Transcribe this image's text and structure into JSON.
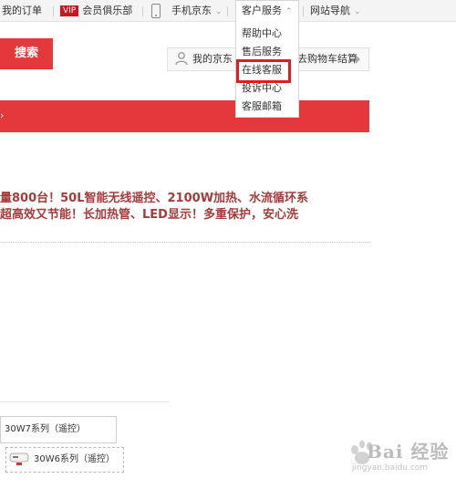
{
  "topbar": {
    "my_orders": "我的订单",
    "vip_badge": "VIP",
    "vip_club": "会员俱乐部",
    "mobile_jd": "手机京东",
    "customer_service": "客户服务",
    "site_nav": "网站导航",
    "caret": "⌄",
    "mobile_icon": "phone-icon"
  },
  "service_menu": {
    "items": [
      "帮助中心",
      "售后服务",
      "在线客服",
      "投诉中心",
      "客服邮箱"
    ],
    "highlighted_index": 2,
    "highlight_color": "#e01c1c"
  },
  "search": {
    "button_label": "搜索",
    "accent_color": "#e4393c"
  },
  "cart": {
    "left_text": "我的京东",
    "right_text": "去购物车结算"
  },
  "product": {
    "headline_line1": "量800台！50L智能无线遥控、2100W加热、水流循环系",
    "headline_line2": "超高效又节能！长加热管、LED显示！多重保护，安心洗",
    "headline_color": "#a73a3a"
  },
  "models": {
    "option1": "30W7系列（遥控）",
    "option2": "30W6系列（遥控）"
  },
  "watermark": {
    "text": "Bai 经验",
    "url": "jingyan.baidu.com"
  }
}
